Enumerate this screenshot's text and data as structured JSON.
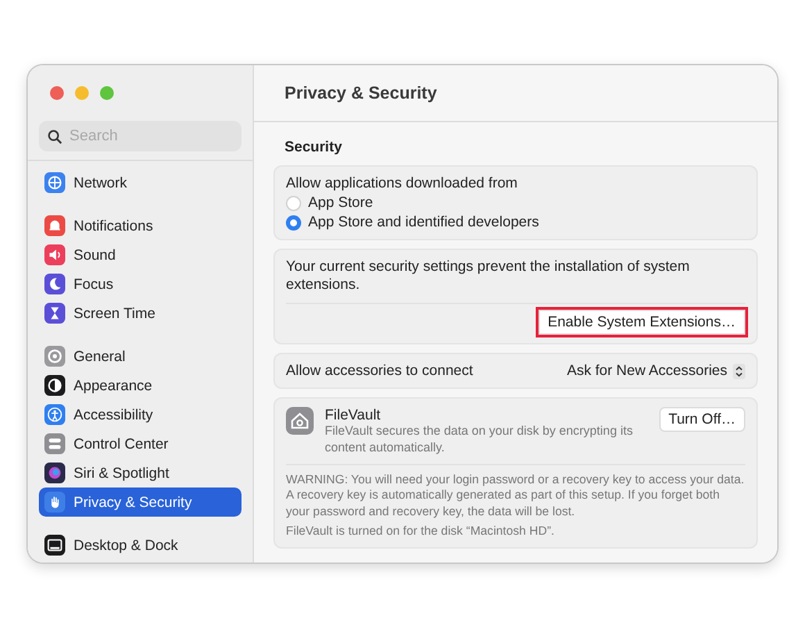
{
  "window": {
    "title": "Privacy & Security"
  },
  "search": {
    "placeholder": "Search"
  },
  "sidebar": {
    "groups": [
      {
        "items": [
          {
            "label": "Network",
            "kind": "globe",
            "color": "#3b82f0",
            "selected": false
          }
        ]
      },
      {
        "items": [
          {
            "label": "Notifications",
            "kind": "bell",
            "color": "#ec4a44",
            "selected": false
          },
          {
            "label": "Sound",
            "kind": "speaker",
            "color": "#ec3f5c",
            "selected": false
          },
          {
            "label": "Focus",
            "kind": "moon",
            "color": "#5b4fd8",
            "selected": false
          },
          {
            "label": "Screen Time",
            "kind": "hourglass",
            "color": "#5b4fd8",
            "selected": false
          }
        ]
      },
      {
        "items": [
          {
            "label": "General",
            "kind": "gear",
            "color": "#9a9a9e",
            "selected": false
          },
          {
            "label": "Appearance",
            "kind": "contrast",
            "color": "#1c1c1e",
            "selected": false
          },
          {
            "label": "Accessibility",
            "kind": "person",
            "color": "#2f7ff0",
            "selected": false
          },
          {
            "label": "Control Center",
            "kind": "toggles",
            "color": "#8e8e93",
            "selected": false
          },
          {
            "label": "Siri & Spotlight",
            "kind": "orb",
            "color": "#2a2a4a",
            "selected": false
          },
          {
            "label": "Privacy & Security",
            "kind": "hand",
            "color": "#3d7fe6",
            "selected": true
          }
        ]
      },
      {
        "items": [
          {
            "label": "Desktop & Dock",
            "kind": "dock",
            "color": "#1c1c1e",
            "selected": false
          }
        ]
      }
    ]
  },
  "content": {
    "section_title": "Security",
    "downloads": {
      "label": "Allow applications downloaded from",
      "options": [
        {
          "label": "App Store",
          "selected": false
        },
        {
          "label": "App Store and identified developers",
          "selected": true
        }
      ]
    },
    "extensions": {
      "message": "Your current security settings prevent the installation of system extensions.",
      "button": {
        "label": "Enable System Extensions…",
        "highlighted": true
      }
    },
    "accessories": {
      "label": "Allow accessories to connect",
      "value": "Ask for New Accessories"
    },
    "filevault": {
      "title": "FileVault",
      "description": "FileVault secures the data on your disk by encrypting its content automatically.",
      "button": "Turn Off…",
      "warning": "WARNING: You will need your login password or a recovery key to access your data. A recovery key is automatically generated as part of this setup. If you forget both your password and recovery key, the data will be lost.",
      "status": "FileVault is turned on for the disk “Macintosh HD”."
    }
  }
}
